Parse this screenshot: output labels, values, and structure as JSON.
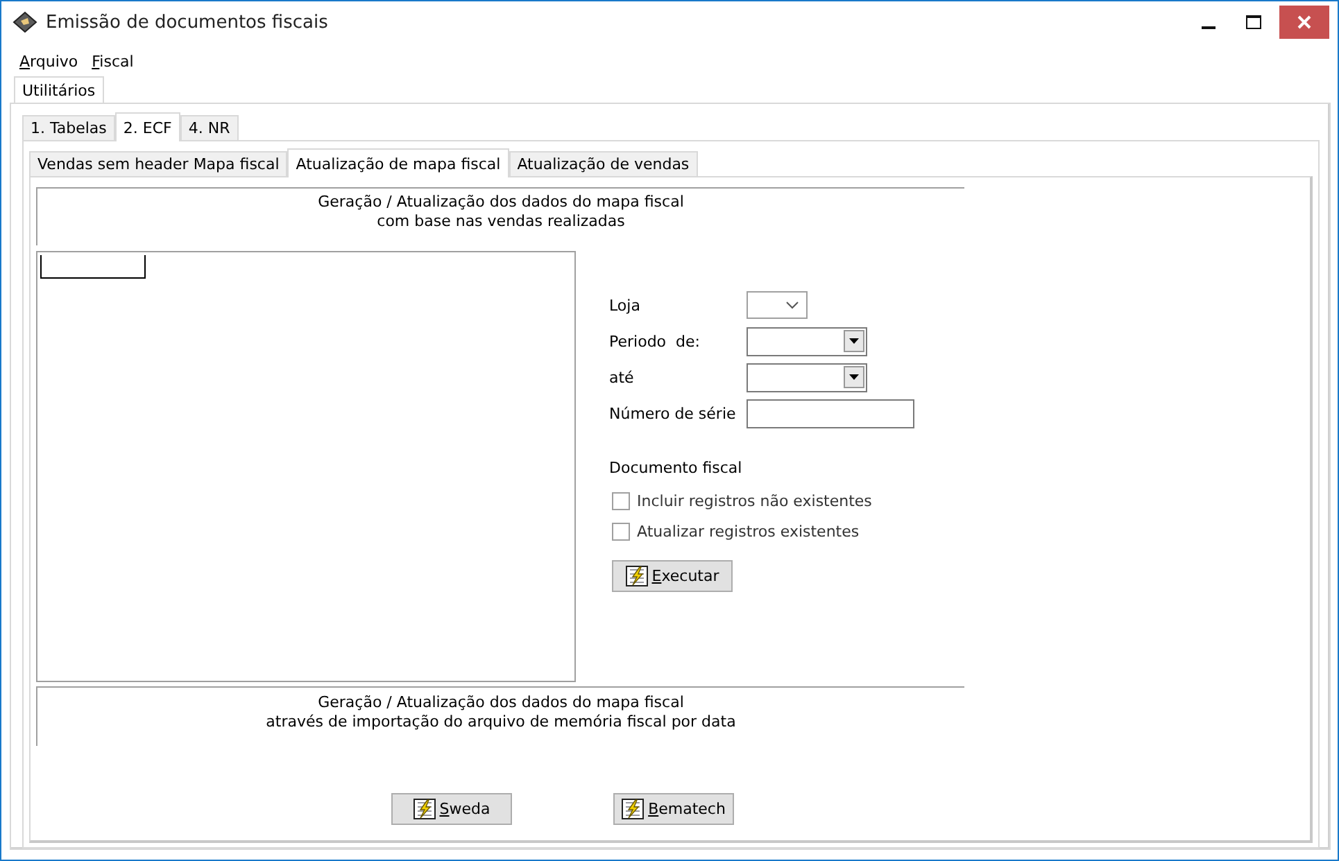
{
  "window": {
    "title": "Emissão de documentos fiscais"
  },
  "menu": [
    {
      "label": "Arquivo"
    },
    {
      "label": "Fiscal"
    }
  ],
  "outer_tabs": [
    {
      "label": "Utilitários",
      "selected": true
    }
  ],
  "tabs": [
    {
      "label": "1. Tabelas",
      "selected": false
    },
    {
      "label": "2. ECF",
      "selected": true
    },
    {
      "label": "4. NR",
      "selected": false
    }
  ],
  "sub_tabs": [
    {
      "label": "Vendas sem header Mapa fiscal",
      "selected": false
    },
    {
      "label": "Atualização de mapa fiscal",
      "selected": true
    },
    {
      "label": "Atualização de vendas",
      "selected": false
    }
  ],
  "top_group": {
    "lines": [
      "Geração / Atualização dos dados do mapa fiscal",
      "com base nas vendas realizadas"
    ]
  },
  "form": {
    "fields": [
      {
        "label": "Loja",
        "kind": "combo"
      },
      {
        "label": "Periodo  de:",
        "kind": "date"
      },
      {
        "label": "até",
        "kind": "date"
      },
      {
        "label": "Número de série",
        "kind": "text"
      }
    ],
    "section": "Documento fiscal",
    "checkboxes": [
      {
        "label": "Incluir registros não existentes",
        "checked": false
      },
      {
        "label": "Atualizar registros existentes",
        "checked": false
      }
    ],
    "button": "Executar"
  },
  "bottom_group": {
    "lines": [
      "Geração / Atualização dos dados do mapa fiscal",
      "através de importação do arquivo de memória fiscal por data"
    ]
  },
  "buttons": [
    "Sweda",
    "Bematech"
  ]
}
